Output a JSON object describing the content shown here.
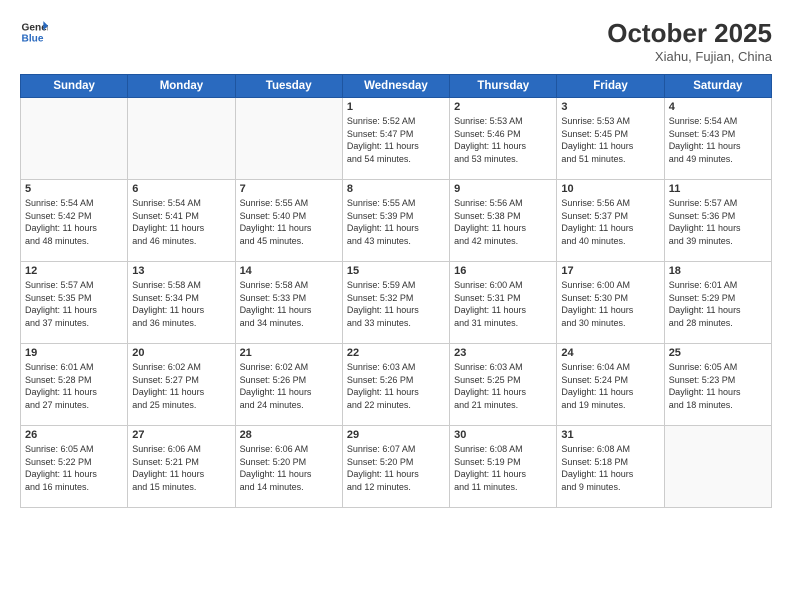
{
  "logo": {
    "line1": "General",
    "line2": "Blue"
  },
  "header": {
    "title": "October 2025",
    "subtitle": "Xiahu, Fujian, China"
  },
  "weekdays": [
    "Sunday",
    "Monday",
    "Tuesday",
    "Wednesday",
    "Thursday",
    "Friday",
    "Saturday"
  ],
  "weeks": [
    [
      {
        "day": "",
        "info": ""
      },
      {
        "day": "",
        "info": ""
      },
      {
        "day": "",
        "info": ""
      },
      {
        "day": "1",
        "info": "Sunrise: 5:52 AM\nSunset: 5:47 PM\nDaylight: 11 hours\nand 54 minutes."
      },
      {
        "day": "2",
        "info": "Sunrise: 5:53 AM\nSunset: 5:46 PM\nDaylight: 11 hours\nand 53 minutes."
      },
      {
        "day": "3",
        "info": "Sunrise: 5:53 AM\nSunset: 5:45 PM\nDaylight: 11 hours\nand 51 minutes."
      },
      {
        "day": "4",
        "info": "Sunrise: 5:54 AM\nSunset: 5:43 PM\nDaylight: 11 hours\nand 49 minutes."
      }
    ],
    [
      {
        "day": "5",
        "info": "Sunrise: 5:54 AM\nSunset: 5:42 PM\nDaylight: 11 hours\nand 48 minutes."
      },
      {
        "day": "6",
        "info": "Sunrise: 5:54 AM\nSunset: 5:41 PM\nDaylight: 11 hours\nand 46 minutes."
      },
      {
        "day": "7",
        "info": "Sunrise: 5:55 AM\nSunset: 5:40 PM\nDaylight: 11 hours\nand 45 minutes."
      },
      {
        "day": "8",
        "info": "Sunrise: 5:55 AM\nSunset: 5:39 PM\nDaylight: 11 hours\nand 43 minutes."
      },
      {
        "day": "9",
        "info": "Sunrise: 5:56 AM\nSunset: 5:38 PM\nDaylight: 11 hours\nand 42 minutes."
      },
      {
        "day": "10",
        "info": "Sunrise: 5:56 AM\nSunset: 5:37 PM\nDaylight: 11 hours\nand 40 minutes."
      },
      {
        "day": "11",
        "info": "Sunrise: 5:57 AM\nSunset: 5:36 PM\nDaylight: 11 hours\nand 39 minutes."
      }
    ],
    [
      {
        "day": "12",
        "info": "Sunrise: 5:57 AM\nSunset: 5:35 PM\nDaylight: 11 hours\nand 37 minutes."
      },
      {
        "day": "13",
        "info": "Sunrise: 5:58 AM\nSunset: 5:34 PM\nDaylight: 11 hours\nand 36 minutes."
      },
      {
        "day": "14",
        "info": "Sunrise: 5:58 AM\nSunset: 5:33 PM\nDaylight: 11 hours\nand 34 minutes."
      },
      {
        "day": "15",
        "info": "Sunrise: 5:59 AM\nSunset: 5:32 PM\nDaylight: 11 hours\nand 33 minutes."
      },
      {
        "day": "16",
        "info": "Sunrise: 6:00 AM\nSunset: 5:31 PM\nDaylight: 11 hours\nand 31 minutes."
      },
      {
        "day": "17",
        "info": "Sunrise: 6:00 AM\nSunset: 5:30 PM\nDaylight: 11 hours\nand 30 minutes."
      },
      {
        "day": "18",
        "info": "Sunrise: 6:01 AM\nSunset: 5:29 PM\nDaylight: 11 hours\nand 28 minutes."
      }
    ],
    [
      {
        "day": "19",
        "info": "Sunrise: 6:01 AM\nSunset: 5:28 PM\nDaylight: 11 hours\nand 27 minutes."
      },
      {
        "day": "20",
        "info": "Sunrise: 6:02 AM\nSunset: 5:27 PM\nDaylight: 11 hours\nand 25 minutes."
      },
      {
        "day": "21",
        "info": "Sunrise: 6:02 AM\nSunset: 5:26 PM\nDaylight: 11 hours\nand 24 minutes."
      },
      {
        "day": "22",
        "info": "Sunrise: 6:03 AM\nSunset: 5:26 PM\nDaylight: 11 hours\nand 22 minutes."
      },
      {
        "day": "23",
        "info": "Sunrise: 6:03 AM\nSunset: 5:25 PM\nDaylight: 11 hours\nand 21 minutes."
      },
      {
        "day": "24",
        "info": "Sunrise: 6:04 AM\nSunset: 5:24 PM\nDaylight: 11 hours\nand 19 minutes."
      },
      {
        "day": "25",
        "info": "Sunrise: 6:05 AM\nSunset: 5:23 PM\nDaylight: 11 hours\nand 18 minutes."
      }
    ],
    [
      {
        "day": "26",
        "info": "Sunrise: 6:05 AM\nSunset: 5:22 PM\nDaylight: 11 hours\nand 16 minutes."
      },
      {
        "day": "27",
        "info": "Sunrise: 6:06 AM\nSunset: 5:21 PM\nDaylight: 11 hours\nand 15 minutes."
      },
      {
        "day": "28",
        "info": "Sunrise: 6:06 AM\nSunset: 5:20 PM\nDaylight: 11 hours\nand 14 minutes."
      },
      {
        "day": "29",
        "info": "Sunrise: 6:07 AM\nSunset: 5:20 PM\nDaylight: 11 hours\nand 12 minutes."
      },
      {
        "day": "30",
        "info": "Sunrise: 6:08 AM\nSunset: 5:19 PM\nDaylight: 11 hours\nand 11 minutes."
      },
      {
        "day": "31",
        "info": "Sunrise: 6:08 AM\nSunset: 5:18 PM\nDaylight: 11 hours\nand 9 minutes."
      },
      {
        "day": "",
        "info": ""
      }
    ]
  ]
}
